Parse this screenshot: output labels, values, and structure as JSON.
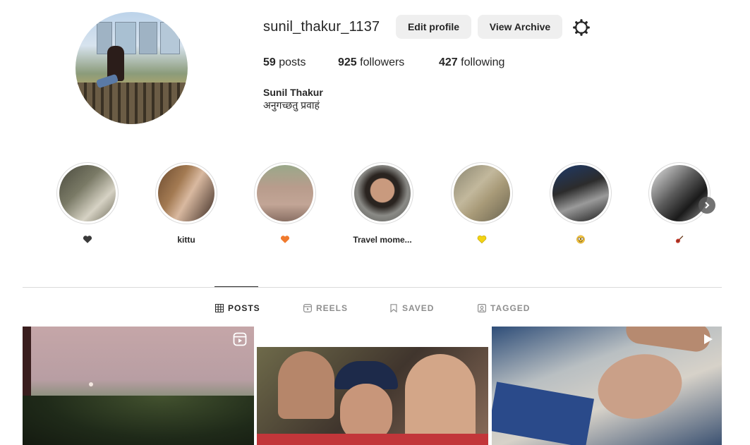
{
  "profile": {
    "username": "sunil_thakur_1137",
    "edit_label": "Edit profile",
    "archive_label": "View Archive",
    "stats": {
      "posts_count": "59",
      "posts_label": "posts",
      "followers_count": "925",
      "followers_label": "followers",
      "following_count": "427",
      "following_label": "following"
    },
    "full_name": "Sunil Thakur",
    "bio": "अनुगच्छतु प्रवाहं"
  },
  "highlights": [
    {
      "label": "🖤",
      "icon": "black-heart"
    },
    {
      "label": "kittu",
      "icon": ""
    },
    {
      "label": "🧡",
      "icon": "orange-heart"
    },
    {
      "label": "Travel mome...",
      "icon": ""
    },
    {
      "label": "💛",
      "icon": "yellow-heart"
    },
    {
      "label": "🤓",
      "icon": "nerd-face"
    },
    {
      "label": "🎸",
      "icon": "guitar"
    }
  ],
  "tabs": [
    {
      "label": "POSTS",
      "icon": "grid-icon",
      "active": true
    },
    {
      "label": "REELS",
      "icon": "reels-icon",
      "active": false
    },
    {
      "label": "SAVED",
      "icon": "bookmark-icon",
      "active": false
    },
    {
      "label": "TAGGED",
      "icon": "tagged-icon",
      "active": false
    }
  ],
  "posts": [
    {
      "type": "reel",
      "icon": "reels-icon"
    },
    {
      "type": "photo",
      "icon": ""
    },
    {
      "type": "video",
      "icon": "play-icon"
    }
  ],
  "colors": {
    "text": "#262626",
    "muted": "#8e8e8e",
    "button_bg": "#efefef",
    "border": "#dbdbdb"
  }
}
